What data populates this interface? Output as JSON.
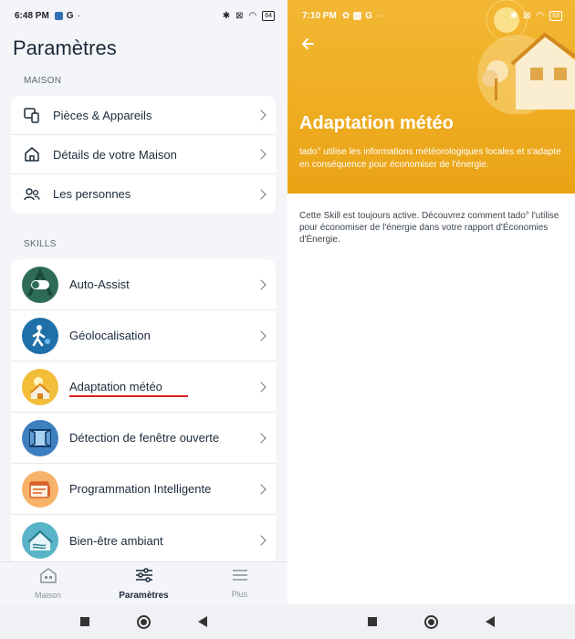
{
  "left": {
    "status": {
      "time": "6:48 PM",
      "battery": "64"
    },
    "title": "Paramètres",
    "maison_section": "MAISON",
    "maison_items": [
      {
        "label": "Pièces & Appareils",
        "icon": "devices-icon"
      },
      {
        "label": "Détails de votre Maison",
        "icon": "house-icon"
      },
      {
        "label": "Les personnes",
        "icon": "people-icon"
      }
    ],
    "skills_section": "SKILLS",
    "skills": [
      {
        "label": "Auto-Assist",
        "icon": "auto-assist-icon",
        "color": "#2e6b58"
      },
      {
        "label": "Géolocalisation",
        "icon": "geolocation-icon",
        "color": "#1f6fa8"
      },
      {
        "label": "Adaptation météo",
        "icon": "weather-adaptation-icon",
        "color": "#f2be3a"
      },
      {
        "label": "Détection de fenêtre ouverte",
        "icon": "open-window-icon",
        "color": "#3d7fbf"
      },
      {
        "label": "Programmation Intelligente",
        "icon": "smart-schedule-icon",
        "color": "#f3a35a"
      },
      {
        "label": "Bien-être ambiant",
        "icon": "ambient-comfort-icon",
        "color": "#5ab4c8"
      }
    ],
    "tabs": [
      {
        "label": "Maison",
        "icon": "house-tab-icon"
      },
      {
        "label": "Paramètres",
        "icon": "sliders-tab-icon"
      },
      {
        "label": "Plus",
        "icon": "menu-tab-icon"
      }
    ]
  },
  "right": {
    "status": {
      "time": "7:10 PM",
      "battery": "63"
    },
    "title": "Adaptation météo",
    "description": "tado° utilise les informations météorologiques locales et s'adapte en conséquence pour économiser de l'énergie.",
    "body": "Cette Skill est toujours active. Découvrez comment tado° l'utilise pour économiser de l'énergie dans votre rapport d'Économies d'Énergie."
  },
  "colors": {
    "accent_yellow": "#f0ae24",
    "text_dark": "#1b2a3a",
    "highlight_red": "#d62020"
  }
}
